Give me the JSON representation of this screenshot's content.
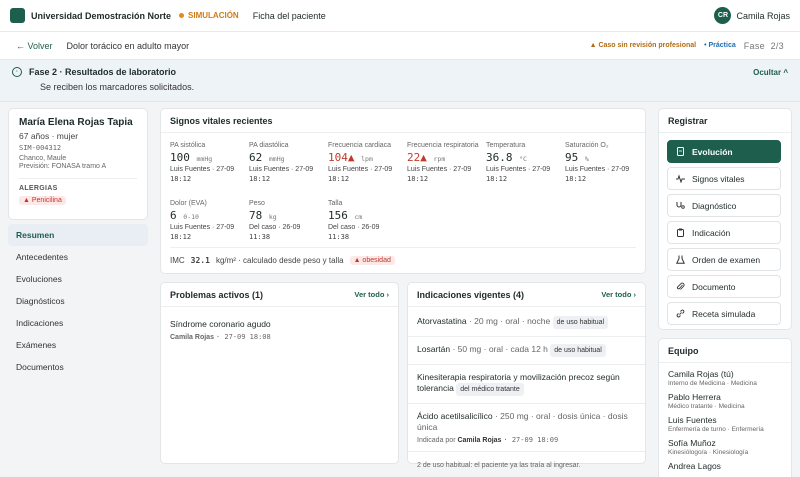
{
  "topbar": {
    "brand": "Universidad Demostración Norte",
    "sim_label": "SIMULACIÓN",
    "nav_link": "Ficha del paciente",
    "user_initials": "CR",
    "user_name": "Camila Rojas"
  },
  "subbar": {
    "back_label": "← Volver",
    "case_title": "Dolor torácico en adulto mayor",
    "badge_review": "▲ Caso sin revisión profesional",
    "badge_practice": "• Práctica",
    "phase_label": "Fase",
    "phase_count": "2/3"
  },
  "banner": {
    "title": "Fase 2 · Resultados de laboratorio",
    "description": "Se reciben los marcadores solicitados.",
    "hide_label": "Ocultar ^"
  },
  "patient": {
    "name": "María Elena Rojas Tapia",
    "age_sex": "67 años · mujer",
    "id": "SIM-004312",
    "location": "Chanco, Maule",
    "insurance": "Previsión: FONASA tramo A",
    "allergies_label": "ALERGIAS",
    "allergies": [
      "▲ Penicilina"
    ]
  },
  "leftnav": [
    {
      "label": "Resumen",
      "active": true
    },
    {
      "label": "Antecedentes"
    },
    {
      "label": "Evoluciones"
    },
    {
      "label": "Diagnósticos"
    },
    {
      "label": "Indicaciones"
    },
    {
      "label": "Exámenes"
    },
    {
      "label": "Documentos"
    }
  ],
  "vitals": {
    "title": "Signos vitales recientes",
    "items": [
      {
        "label": "PA sistólica",
        "value": "100",
        "unit": "mmHg",
        "meta1": "Luis Fuentes · 27-09",
        "meta2": "18:12"
      },
      {
        "label": "PA diastólica",
        "value": "62",
        "unit": "mmHg",
        "meta1": "Luis Fuentes · 27-09",
        "meta2": "18:12"
      },
      {
        "label": "Frecuencia cardiaca",
        "value": "104▲",
        "unit": "lpm",
        "meta1": "Luis Fuentes · 27-09",
        "meta2": "18:12",
        "alert": true
      },
      {
        "label": "Frecuencia respiratoria",
        "value": "22▲",
        "unit": "rpm",
        "meta1": "Luis Fuentes · 27-09",
        "meta2": "18:12",
        "alert": true
      },
      {
        "label": "Temperatura",
        "value": "36.8",
        "unit": "°C",
        "meta1": "Luis Fuentes · 27-09",
        "meta2": "18:12"
      },
      {
        "label": "Saturación O₂",
        "value": "95",
        "unit": "%",
        "meta1": "Luis Fuentes · 27-09",
        "meta2": "18:12"
      },
      {
        "label": "Dolor (EVA)",
        "value": "6",
        "unit": "0-10",
        "meta1": "Luis Fuentes · 27-09",
        "meta2": "18:12"
      },
      {
        "label": "Peso",
        "value": "78",
        "unit": "kg",
        "meta1": "Del caso · 26-09",
        "meta2": "11:38"
      },
      {
        "label": "Talla",
        "value": "156",
        "unit": "cm",
        "meta1": "Del caso · 26-09",
        "meta2": "11:38"
      }
    ],
    "imc_prefix": "IMC",
    "imc_value": "32.1",
    "imc_suffix": "kg/m² · calculado desde peso y talla",
    "imc_flag": "▲ obesidad"
  },
  "problems": {
    "title": "Problemas activos (1)",
    "see_all": "Ver todo ›",
    "items": [
      {
        "name": "Síndrome coronario agudo",
        "author": "Camila Rojas",
        "date": "· 27-09 18:08"
      }
    ]
  },
  "indications": {
    "title": "Indicaciones vigentes (4)",
    "see_all": "Ver todo ›",
    "items": [
      {
        "name": "Atorvastatina",
        "detail": " · 20 mg · oral · noche",
        "chip": "de uso habitual"
      },
      {
        "name": "Losartán",
        "detail": " · 50 mg · oral · cada 12 h",
        "chip": "de uso habitual"
      },
      {
        "name": "Kinesiterapia respiratoria y movilización precoz según tolerancia",
        "detail": "",
        "chip": "del médico tratante"
      },
      {
        "name": "Ácido acetilsalicílico",
        "detail": " · 250 mg · oral · dosis única · dosis única",
        "sub_prefix": "Indicada por",
        "sub_author": "Camila Rojas",
        "sub_date": "· 27-09 18:09"
      }
    ],
    "footnote": "2 de uso habitual: el paciente ya las traía al ingresar."
  },
  "register": {
    "title": "Registrar",
    "buttons": [
      {
        "label": "Evolución",
        "icon": "document-icon",
        "active": true
      },
      {
        "label": "Signos vitales",
        "icon": "pulse-icon"
      },
      {
        "label": "Diagnóstico",
        "icon": "stethoscope-icon"
      },
      {
        "label": "Indicación",
        "icon": "clipboard-icon"
      },
      {
        "label": "Orden de examen",
        "icon": "flask-icon"
      },
      {
        "label": "Documento",
        "icon": "paperclip-icon"
      },
      {
        "label": "Receta simulada",
        "icon": "link-icon"
      }
    ]
  },
  "team": {
    "title": "Equipo",
    "members": [
      {
        "name": "Camila Rojas (tú)",
        "role": "Interno de Medicina · Medicina"
      },
      {
        "name": "Pablo Herrera",
        "role": "Médico tratante · Medicina"
      },
      {
        "name": "Luis Fuentes",
        "role": "Enfermería de turno · Enfermería"
      },
      {
        "name": "Sofía Muñoz",
        "role": "Kinesiólogo/a · Kinesiología"
      },
      {
        "name": "Andrea Lagos",
        "role": ""
      }
    ]
  },
  "colors": {
    "primary": "#1e5e4d",
    "alert": "#c0392b",
    "warning": "#d07b16",
    "info": "#1f6fb2"
  }
}
